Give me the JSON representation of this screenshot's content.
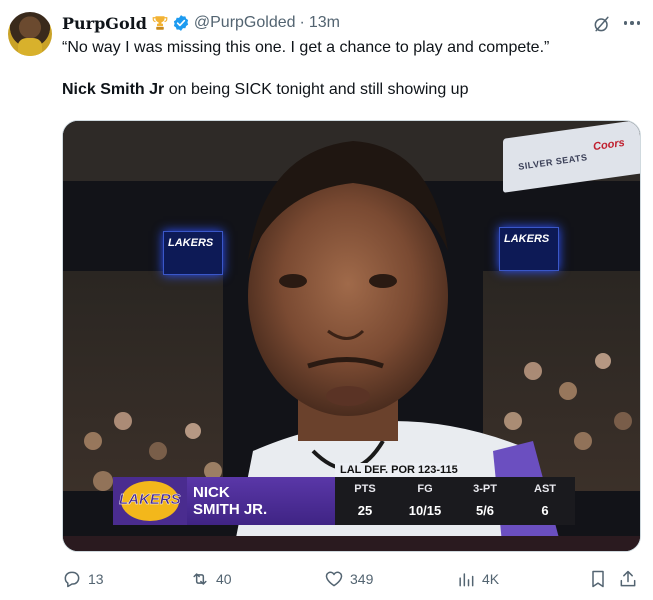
{
  "author": {
    "display_name": "PurpGold",
    "handle": "@PurpGolded",
    "separator": "·",
    "time": "13m",
    "badge_icon": "trophy-icon",
    "verified_icon": "verified-badge-icon",
    "verified_color": "#1d9bf0"
  },
  "tweet": {
    "quote": "“No way I was missing this one. I get a chance to play and compete.”",
    "subject_name": "Nick Smith Jr",
    "subject_rest": " on being SICK tonight and still showing up"
  },
  "media": {
    "signage": {
      "silver_seats": "SILVER SEATS",
      "coors": "Coors",
      "lakers_screen_1": "LAKERS",
      "lakers_screen_2": "LAKERS"
    },
    "broadcast": {
      "score_line": "LAL DEF. POR 123-115",
      "team_logo_text": "LAKERS",
      "player_first": "NICK",
      "player_last": "SMITH JR.",
      "stats": [
        {
          "label": "PTS",
          "value": "25"
        },
        {
          "label": "FG",
          "value": "10/15"
        },
        {
          "label": "3-PT",
          "value": "5/6"
        },
        {
          "label": "AST",
          "value": "6"
        }
      ],
      "team_color": "#552583",
      "gold_color": "#FDB927"
    }
  },
  "actions": {
    "replies": "13",
    "reposts": "40",
    "likes": "349",
    "views": "4K"
  },
  "colors": {
    "text_primary": "#0f1419",
    "text_secondary": "#536471"
  }
}
